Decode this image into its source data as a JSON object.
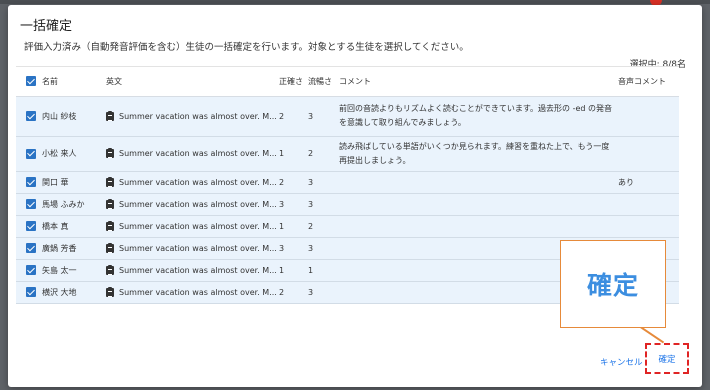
{
  "dialog": {
    "title": "一括確定",
    "description": "評価入力済み（自動発音評価を含む）生徒の一括確定を行います。対象とする生徒を選択してください。",
    "selection_count": "選択中: 8/8名"
  },
  "table": {
    "headers": {
      "name": "名前",
      "english": "英文",
      "accuracy": "正確さ",
      "fluency": "流暢さ",
      "comment": "コメント",
      "voice_comment": "音声コメント"
    },
    "rows": [
      {
        "name": "内山 紗枝",
        "english": "Summer vacation was almost over. M...",
        "accuracy": "2",
        "fluency": "3",
        "comment": "前回の音読よりもリズムよく読むことができています。過去形の -ed の発音を意識して取り組んでみましょう。",
        "voice_comment": ""
      },
      {
        "name": "小松 来人",
        "english": "Summer vacation was almost over. M...",
        "accuracy": "1",
        "fluency": "2",
        "comment": "読み飛ばしている単語がいくつか見られます。練習を重ねた上で、もう一度再提出しましょう。",
        "voice_comment": ""
      },
      {
        "name": "関口 華",
        "english": "Summer vacation was almost over. M...",
        "accuracy": "2",
        "fluency": "3",
        "comment": "",
        "voice_comment": "あり"
      },
      {
        "name": "馬場 ふみか",
        "english": "Summer vacation was almost over. M...",
        "accuracy": "3",
        "fluency": "3",
        "comment": "",
        "voice_comment": ""
      },
      {
        "name": "橋本 真",
        "english": "Summer vacation was almost over. M...",
        "accuracy": "1",
        "fluency": "2",
        "comment": "",
        "voice_comment": ""
      },
      {
        "name": "廣鍋 芳香",
        "english": "Summer vacation was almost over. M...",
        "accuracy": "3",
        "fluency": "3",
        "comment": "",
        "voice_comment": ""
      },
      {
        "name": "矢島 太一",
        "english": "Summer vacation was almost over. M...",
        "accuracy": "1",
        "fluency": "1",
        "comment": "",
        "voice_comment": ""
      },
      {
        "name": "横沢 大地",
        "english": "Summer vacation was almost over. M...",
        "accuracy": "2",
        "fluency": "3",
        "comment": "",
        "voice_comment": ""
      }
    ]
  },
  "footer": {
    "cancel_label": "キャンセル",
    "confirm_label": "確定"
  },
  "callout": {
    "text": "確定"
  },
  "colors": {
    "accent": "#1a73e8",
    "checkbox": "#2a73c4",
    "row_background": "#eaf3fc",
    "highlight_border": "#e02424",
    "callout_border": "#e68a3a",
    "callout_text": "#3c8ee0"
  }
}
